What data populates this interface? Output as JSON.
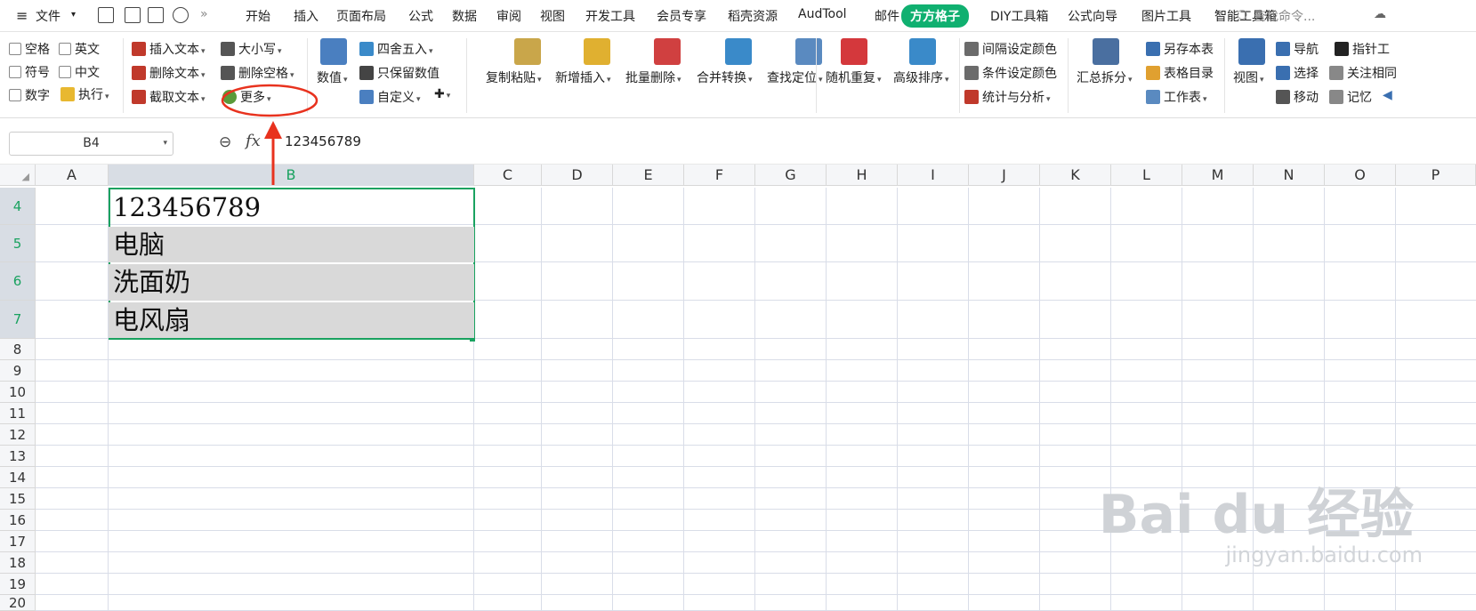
{
  "menubar": {
    "file_label": "文件",
    "tabs": [
      "开始",
      "插入",
      "页面布局",
      "公式",
      "数据",
      "审阅",
      "视图",
      "开发工具",
      "会员专享",
      "稻壳资源",
      "AudTool",
      "邮件",
      "方方格子",
      "DIY工具箱",
      "公式向导",
      "图片工具",
      "智能工具箱"
    ],
    "active_tab": "方方格子",
    "search_placeholder": "查找命令..."
  },
  "ribbon": {
    "check_group": [
      "空格",
      "英文",
      "符号",
      "中文",
      "数字"
    ],
    "execute_label": "执行",
    "text_group": [
      "插入文本",
      "删除文本",
      "截取文本"
    ],
    "case_label": "大小写",
    "delete_space_label": "删除空格",
    "more_label": "更多",
    "number_label": "数值",
    "round_label": "四舍五入",
    "keep_number_label": "只保留数值",
    "custom_label": "自定义",
    "big_buttons": [
      "复制粘贴",
      "新增插入",
      "批量删除",
      "合并转换",
      "查找定位"
    ],
    "random_repeat_label": "随机重复",
    "advanced_sort_label": "高级排序",
    "color_group": [
      "间隔设定颜色",
      "条件设定颜色",
      "统计与分析"
    ],
    "summary_split_label": "汇总拆分",
    "save_sheet_label": "另存本表",
    "table_toc_label": "表格目录",
    "worksheet_label": "工作表",
    "view_label": "视图",
    "nav_label": "导航",
    "select_label": "选择",
    "move_label": "移动",
    "pointer_tool_label": "指针工",
    "follow_same_label": "关注相同",
    "memory_label": "记忆"
  },
  "formula_bar": {
    "name_box": "B4",
    "fx": "fx",
    "value": "123456789"
  },
  "columns": [
    "A",
    "B",
    "C",
    "D",
    "E",
    "F",
    "G",
    "H",
    "I",
    "J",
    "K",
    "L",
    "M",
    "N",
    "O",
    "P"
  ],
  "rows": [
    "4",
    "5",
    "6",
    "7",
    "8",
    "9",
    "10",
    "11",
    "12",
    "13",
    "14",
    "15",
    "16",
    "17",
    "18",
    "19",
    "20"
  ],
  "cells": {
    "B4": "123456789",
    "B5": "电脑",
    "B6": "洗面奶",
    "B7": "电风扇"
  },
  "watermark": {
    "main": "Bai du 经验",
    "sub": "jingyan.baidu.com"
  },
  "colors": {
    "accent": "#10b070",
    "selection_border": "#1aa260",
    "annotation": "#e8321e",
    "selected_fill": "#d9d9d9"
  }
}
